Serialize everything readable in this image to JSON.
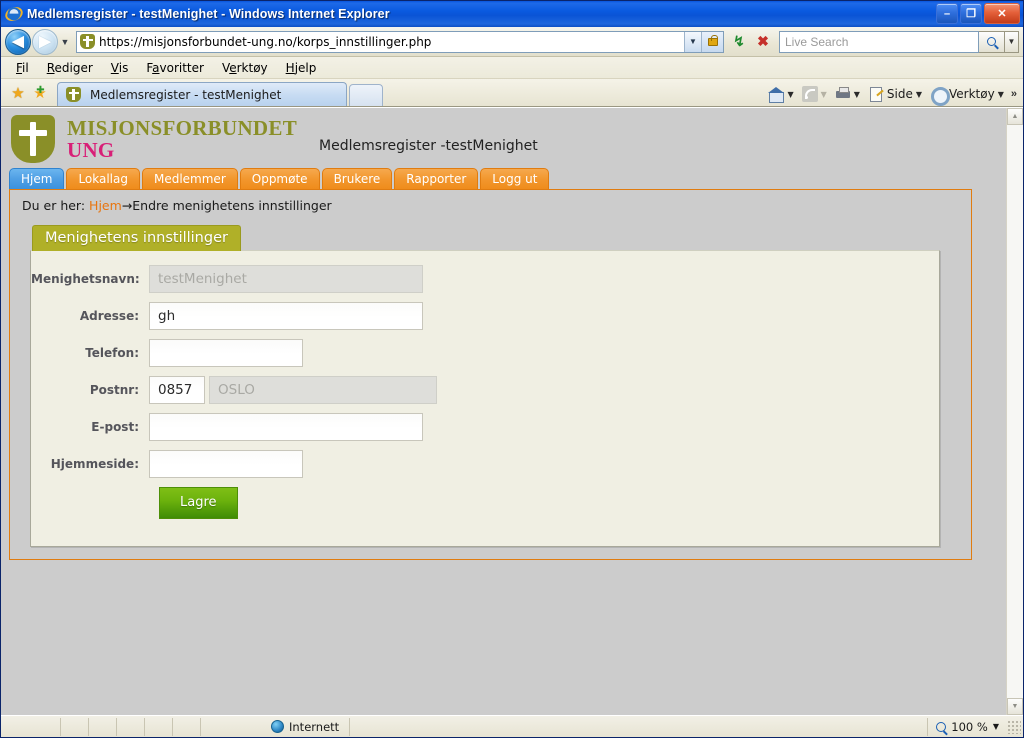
{
  "window": {
    "title": "Medlemsregister - testMenighet - Windows Internet Explorer",
    "minimize_label": "–",
    "maximize_label": "❐",
    "close_label": "✕",
    "ie_icon": "internet-explorer-icon"
  },
  "navigation": {
    "back_label": "◀",
    "forward_label": "▶",
    "history_caret": "▼",
    "url": "https://misjonsforbundet-ung.no/korps_innstillinger.php",
    "url_dropdown_caret": "▼",
    "lock_icon": "ssl-lock-icon",
    "refresh_label": "↯",
    "stop_label": "✖",
    "search_placeholder": "Live Search",
    "search_value": "",
    "search_go_icon": "magnifier-icon",
    "search_caret": "▼"
  },
  "menubar": {
    "items": [
      {
        "pre": "",
        "key": "F",
        "post": "il"
      },
      {
        "pre": "",
        "key": "R",
        "post": "ediger"
      },
      {
        "pre": "",
        "key": "V",
        "post": "is"
      },
      {
        "pre": "F",
        "key": "a",
        "post": "voritter"
      },
      {
        "pre": "V",
        "key": "e",
        "post": "rktøy"
      },
      {
        "pre": "",
        "key": "H",
        "post": "jelp"
      }
    ]
  },
  "tabbar": {
    "favorites_icon": "star-icon",
    "add_favorite_icon": "star-plus-icon",
    "tab_title": "Medlemsregister - testMenighet",
    "tab_favicon": "misjonsforbundet-favicon",
    "new_tab_label": "",
    "commands": [
      {
        "icon": "home-icon",
        "label": "",
        "caret": "▼"
      },
      {
        "icon": "rss-icon",
        "label": "",
        "caret": "▼"
      },
      {
        "icon": "printer-icon",
        "label": "",
        "caret": "▼"
      },
      {
        "icon": "page-icon",
        "label": "Side",
        "caret": "▼"
      },
      {
        "icon": "gear-icon",
        "label": "Verktøy",
        "caret": "▼"
      }
    ],
    "overflow_label": "»"
  },
  "site": {
    "logo_icon": "misjonsforbundet-cross-logo",
    "logo_line1": "MISJONSFORBUNDET",
    "logo_line2": "UNG",
    "subtitle": "Medlemsregister -testMenighet",
    "nav": [
      {
        "label": "Hjem",
        "active": true
      },
      {
        "label": "Lokallag",
        "active": false
      },
      {
        "label": "Medlemmer",
        "active": false
      },
      {
        "label": "Oppmøte",
        "active": false
      },
      {
        "label": "Brukere",
        "active": false
      },
      {
        "label": "Rapporter",
        "active": false
      },
      {
        "label": "Logg ut",
        "active": false
      }
    ],
    "breadcrumb": {
      "prefix": "Du er her: ",
      "link": "Hjem",
      "separator": "→",
      "current": "Endre menighetens innstillinger"
    }
  },
  "form": {
    "card_title": "Menighetens innstillinger",
    "fields": [
      {
        "label": "Menighetsnavn:",
        "value": "testMenighet",
        "placeholder": "",
        "disabled": true,
        "width": "w-wide"
      },
      {
        "label": "Adresse:",
        "value": "gh",
        "placeholder": "",
        "disabled": false,
        "width": "w-wide"
      },
      {
        "label": "Telefon:",
        "value": "",
        "placeholder": "",
        "disabled": false,
        "width": "w-mid"
      },
      {
        "label": "E-post:",
        "value": "",
        "placeholder": "",
        "disabled": false,
        "width": "w-wide"
      },
      {
        "label": "Hjemmeside:",
        "value": "",
        "placeholder": "",
        "disabled": false,
        "width": "w-mid"
      }
    ],
    "postnr": {
      "label": "Postnr:",
      "zip_value": "0857",
      "city_value": "OSLO",
      "city_disabled": true
    },
    "save_button": "Lagre"
  },
  "statusbar": {
    "zone_icon": "internet-zone-icon",
    "zone_label": "Internett",
    "zoom_icon": "zoom-icon",
    "zoom_level": "100 %",
    "zoom_caret": "▼"
  },
  "colors": {
    "titlebar_blue": "#0a5ae0",
    "accent_orange": "#ef8c1c",
    "active_tab_blue": "#4f9fe4",
    "logo_olive": "#8a8f28",
    "logo_magenta": "#d81f77",
    "card_title_olive": "#b0b028",
    "save_green": "#6db30d",
    "page_bg_gray": "#cccccc",
    "card_bg": "#f0efe3"
  }
}
